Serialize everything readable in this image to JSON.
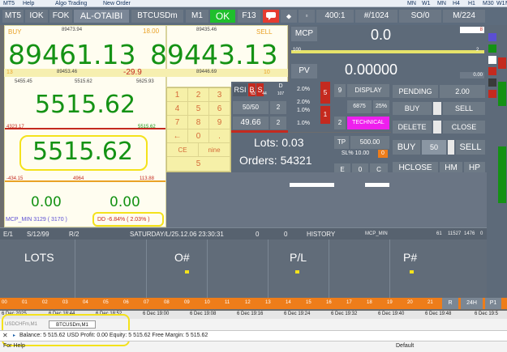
{
  "toolbar": {
    "items": [
      "MT5",
      "Help",
      "Algo Trading",
      "New Order",
      "MN",
      "W1",
      "MN",
      "H4",
      "H1",
      "M30",
      "W1",
      "MN"
    ]
  },
  "top": {
    "mt5": "MT5",
    "iok": "IOK",
    "fok": "FOK",
    "account": "AL-OTAIBI",
    "symbol": "BTCUSDm",
    "timeframe": "M1",
    "ok": "OK",
    "f13": "F13",
    "ratio": "400:1",
    "order_count": "#/1024",
    "so": "SO/0",
    "m224": "M/224"
  },
  "quote": {
    "buy_label": "BUY",
    "buy_small": "89473.94",
    "spread": "18.00",
    "sell_small": "89435.46",
    "sell_label": "SELL",
    "buy_price": "89461.13",
    "sell_price": "89443.13",
    "buy_left": "13",
    "buy_low": "89453.46",
    "change": "-29.9",
    "sell_low": "89446.69",
    "sell_right": "10"
  },
  "stats": {
    "s1": "5455.45",
    "s2": "5515.62",
    "s3": "5625.93",
    "balance_big": "5515.62",
    "dd_left": "4323.17",
    "dd_right": "5515.62",
    "equity_big": "5515.62",
    "m1": "-434.15",
    "m2": "4964",
    "m3": "113.88",
    "profit_left": "0.00",
    "profit_right": "0.00",
    "mcp_min": "MCP_MIN 3129 ( 3170 )",
    "dd": "DD -6.84% ( 2.03% )"
  },
  "keypad": {
    "keys": [
      "1",
      "2",
      "3",
      "4",
      "5",
      "6",
      "7",
      "8",
      "9",
      "←",
      "0",
      ".",
      "CE",
      "nine",
      "5"
    ]
  },
  "right": {
    "mcp": "MCP",
    "mcp_value": "0.0",
    "mcp_badge": "8",
    "v100": "100",
    "v2": "2",
    "pv": "PV",
    "pv_value": "0.00000",
    "pv_small": "0.00",
    "rsi": "RSI",
    "b": "B",
    "s": "S",
    "d": "D",
    "r63": "63",
    "r44": "44",
    "r107": "107",
    "fifty": "50/50",
    "two": "2",
    "fortynine": "49.66",
    "two2": "2",
    "pct1": "2.0%",
    "pct2": "2.0%",
    "pct3": "1.0%",
    "pct4": "1.0%",
    "pct5": "2.0%",
    "n5": "5",
    "n1": "1",
    "nine": "9",
    "display": "DISPLAY",
    "n6875": "6875",
    "p25": "25%",
    "two3": "2",
    "technical": "TECHNICAL",
    "pending": "PENDING",
    "pending_val": "2.00",
    "buy": "BUY",
    "sell": "SELL",
    "delete": "DELETE",
    "close": "CLOSE",
    "lots": "Lots: 0.03",
    "orders": "Orders: 54321",
    "tp": "TP",
    "tp_val": "500.00",
    "sl": "SL% 10.00",
    "sl_badge": "0",
    "e": "E",
    "zero": "0",
    "c": "C",
    "buy2": "BUY",
    "buy2_val": "50",
    "sell2": "SELL",
    "hclose": "HCLOSE",
    "hm": "HM",
    "hp": "HP"
  },
  "infobar": {
    "e1": "E/1",
    "s1299": "S/12/99",
    "r2": "R/2",
    "time": "SATURDAY/L/25.12.06 23:30:31",
    "z1": "0",
    "z2": "0",
    "history": "HISTORY",
    "mcp_min": "MCP_MIN",
    "n61": "61",
    "n11527": "11527",
    "n1476": "1476",
    "z3": "0"
  },
  "grid": {
    "lots": "LOTS",
    "onum": "O#",
    "pl": "P/L",
    "pnum": "P#"
  },
  "orange_labels": [
    "00",
    "01",
    "02",
    "03",
    "04",
    "05",
    "06",
    "07",
    "08",
    "09",
    "10",
    "11",
    "12",
    "13",
    "14",
    "15",
    "16",
    "17",
    "18",
    "19",
    "20",
    "21",
    "22",
    "23"
  ],
  "timeline": {
    "labels": [
      "6 Dec 2025",
      "6 Dec 18:44",
      "6 Dec 18:52",
      "6 Dec 19:00",
      "6 Dec 19:08",
      "6 Dec 19:16",
      "6 Dec 19:24",
      "6 Dec 19:32",
      "6 Dec 19:40",
      "6 Dec 19:48",
      "6 Dec 19:5"
    ],
    "r": "R",
    "h24": "24H",
    "p1": "P1"
  },
  "bottom": {
    "tab1": "USDCHFm,M1",
    "tab2": "BTCUSDm,M1",
    "status": "Balance: 5 515.62 USD  Profit: 0.00  Equity: 5 515.62  Free Margin: 5 515.62",
    "help": "For Help",
    "default": "Default"
  },
  "colors": {
    "green": "#149214",
    "red": "#c42a1f",
    "yellow": "#f4e21c",
    "magenta": "#ee1fee",
    "orange": "#ee7d1a"
  }
}
